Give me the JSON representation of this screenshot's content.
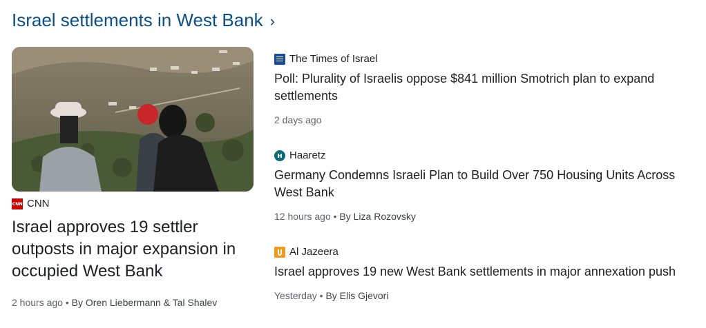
{
  "header": {
    "title": "Israel settlements in West Bank",
    "chevron": "›"
  },
  "feature": {
    "image_alt": "Men in hats looking over hillside settlement",
    "source": "CNN",
    "source_icon": "cnn-logo-icon",
    "title": "Israel approves 19 settler outposts in major expansion in occupied West Bank",
    "time": "2 hours ago",
    "separator": " • ",
    "byline": "By Oren Liebermann & Tal Shalev"
  },
  "stories": [
    {
      "source": "The Times of Israel",
      "source_icon": "times-of-israel-logo-icon",
      "title": "Poll: Plurality of Israelis oppose $841 million Smotrich plan to expand settlements",
      "time": "2 days ago",
      "byline": ""
    },
    {
      "source": "Haaretz",
      "source_icon": "haaretz-logo-icon",
      "title": "Germany Condemns Israeli Plan to Build Over 750 Housing Units Across West Bank",
      "time": "12 hours ago",
      "separator": " • ",
      "byline": "By Liza Rozovsky"
    },
    {
      "source": "Al Jazeera",
      "source_icon": "al-jazeera-logo-icon",
      "title": "Israel approves 19 new West Bank settlements in major annexation push",
      "time": "Yesterday",
      "separator": " • ",
      "byline": "By Elis Gjevori"
    }
  ],
  "colors": {
    "header": "#0b4f87",
    "text": "#202124",
    "meta": "#5f6368",
    "cnn": "#cc0000",
    "aljazeera": "#f29a1d",
    "haaretz": "#0b6b7a",
    "toi": "#1a4c9c"
  }
}
